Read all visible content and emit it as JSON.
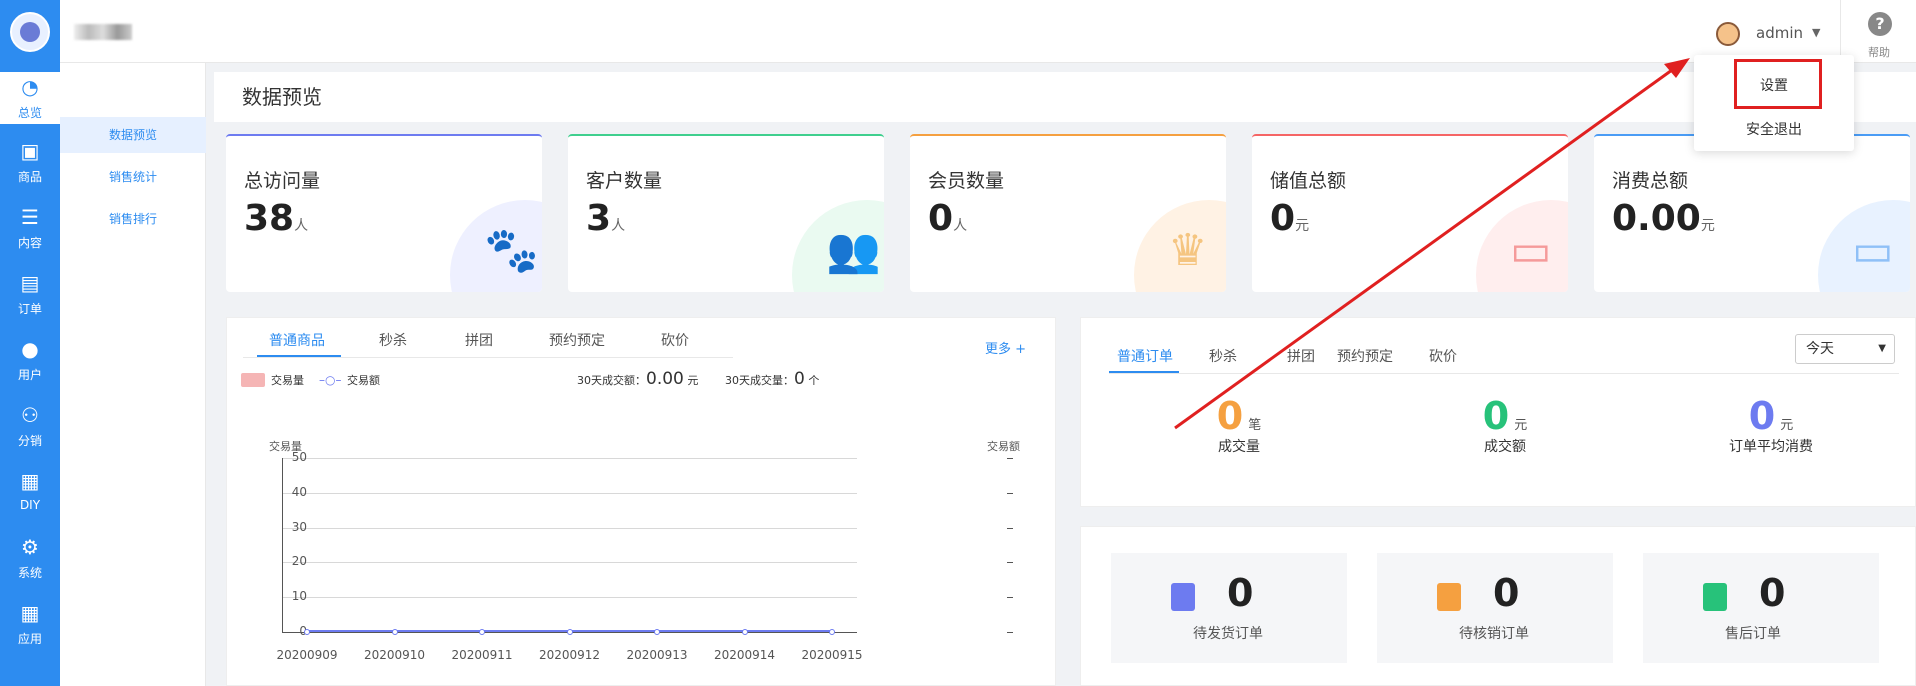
{
  "nav": [
    {
      "label": "总览",
      "icon": "pie-chart-icon",
      "glyph": "◔"
    },
    {
      "label": "商品",
      "icon": "bag-icon",
      "glyph": "▣"
    },
    {
      "label": "内容",
      "icon": "list-icon",
      "glyph": "☰"
    },
    {
      "label": "订单",
      "icon": "document-icon",
      "glyph": "▤"
    },
    {
      "label": "用户",
      "icon": "user-icon",
      "glyph": "●"
    },
    {
      "label": "分销",
      "icon": "group-icon",
      "glyph": "⚇"
    },
    {
      "label": "DIY",
      "icon": "layout-icon",
      "glyph": "▦"
    },
    {
      "label": "系统",
      "icon": "gear-icon",
      "glyph": "⚙"
    },
    {
      "label": "应用",
      "icon": "apps-icon",
      "glyph": "▦"
    }
  ],
  "subnav": [
    "数据预览",
    "销售统计",
    "销售排行"
  ],
  "header": {
    "username": "admin",
    "help": "帮助",
    "help_glyph": "?"
  },
  "dropdown": {
    "settings": "设置",
    "logout": "安全退出"
  },
  "page_title": "数据预览",
  "cards": [
    {
      "title": "总访问量",
      "value": "38",
      "unit": "人",
      "color": "#6d7bf0",
      "icon": "paw-icon",
      "glyph": "🐾",
      "bg": "#eef0ff"
    },
    {
      "title": "客户数量",
      "value": "3",
      "unit": "人",
      "color": "#3fcf8e",
      "icon": "users-icon",
      "glyph": "👥",
      "bg": "#eafaf1"
    },
    {
      "title": "会员数量",
      "value": "0",
      "unit": "人",
      "color": "#f5a040",
      "icon": "crown-icon",
      "glyph": "♛",
      "bg": "#fff2e4"
    },
    {
      "title": "储值总额",
      "value": "0",
      "unit": "元",
      "color": "#f56565",
      "icon": "card-icon",
      "glyph": "▭",
      "bg": "#ffeeee"
    },
    {
      "title": "消费总额",
      "value": "0.00",
      "unit": "元",
      "color": "#4a9cf5",
      "icon": "wallet-icon",
      "glyph": "▭",
      "bg": "#e8f2ff"
    }
  ],
  "goods_panel": {
    "tabs": [
      "普通商品",
      "秒杀",
      "拼团",
      "预约预定",
      "砍价"
    ],
    "more": "更多 +",
    "legend_qty": "交易量",
    "legend_amt": "交易额",
    "sum_amt_label": "30天成交额：",
    "sum_amt_value": "0.00",
    "sum_amt_unit": "元",
    "sum_qty_label": "30天成交量：",
    "sum_qty_value": "0",
    "sum_qty_unit": "个"
  },
  "chart_data": {
    "type": "line",
    "title": "",
    "ylabel": "交易量",
    "y2label": "交易额",
    "ylim": [
      0,
      50
    ],
    "yticks": [
      "50",
      "40",
      "30",
      "20",
      "10",
      "0"
    ],
    "categories": [
      "20200909",
      "20200910",
      "20200911",
      "20200912",
      "20200913",
      "20200914",
      "20200915"
    ],
    "series": [
      {
        "name": "交易量",
        "type": "bar",
        "values": [
          0,
          0,
          0,
          0,
          0,
          0,
          0
        ],
        "color": "#f5a0a0"
      },
      {
        "name": "交易额",
        "type": "line",
        "values": [
          0,
          0,
          0,
          0,
          0,
          0,
          0
        ],
        "color": "#6d7bf0"
      }
    ]
  },
  "order_panel": {
    "tabs": [
      "普通订单",
      "秒杀",
      "拼团",
      "预约预定",
      "砍价"
    ],
    "period": "今天",
    "stats": [
      {
        "value": "0",
        "unit": "笔",
        "label": "成交量",
        "color": "#f5a040"
      },
      {
        "value": "0",
        "unit": "元",
        "label": "成交额",
        "color": "#27c27a"
      },
      {
        "value": "0",
        "unit": "元",
        "label": "订单平均消费",
        "color": "#6d7bf0"
      }
    ]
  },
  "pending": [
    {
      "value": "0",
      "label": "待发货订单",
      "icon": "clipboard-icon",
      "color": "#6d7bf0"
    },
    {
      "value": "0",
      "label": "待核销订单",
      "icon": "verify-icon",
      "color": "#f5a040"
    },
    {
      "value": "0",
      "label": "售后订单",
      "icon": "aftersale-icon",
      "color": "#27c27a"
    }
  ]
}
